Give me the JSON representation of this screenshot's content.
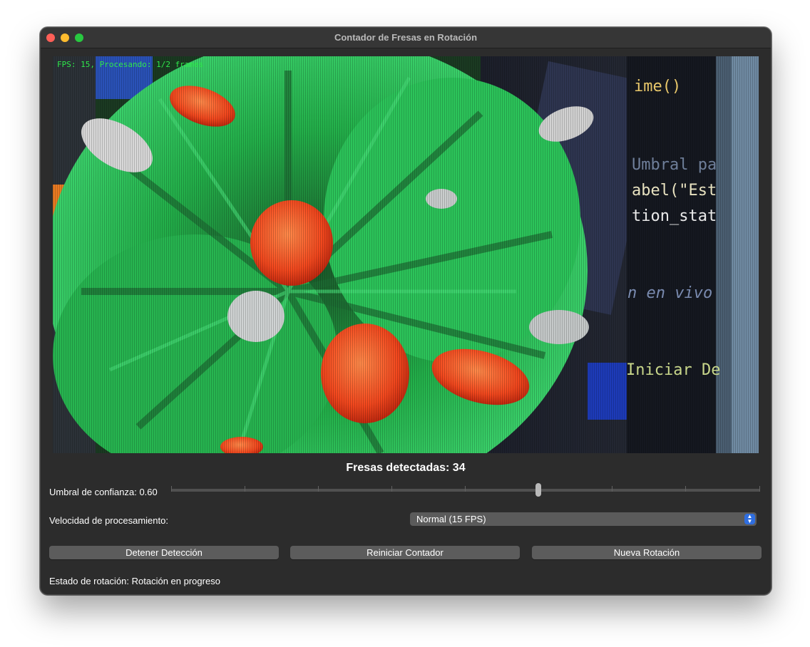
{
  "window": {
    "title": "Contador de Fresas en Rotación"
  },
  "video": {
    "overlay_text": "FPS: 15, Procesando: 1/2 frames",
    "code_lines": [
      "ime()",
      "Umbral pa",
      "abel(\"Est",
      "tion_stat",
      "n en vivo",
      "Iniciar De"
    ]
  },
  "counter": {
    "text": "Fresas detectadas: 34"
  },
  "confidence": {
    "label": "Umbral de confianza: 0.60",
    "value": 0.6
  },
  "speed": {
    "label": "Velocidad de procesamiento:",
    "selected": "Normal (15 FPS)"
  },
  "buttons": {
    "stop": "Detener Detección",
    "reset": "Reiniciar Contador",
    "new_rotation": "Nueva Rotación"
  },
  "status": {
    "text": "Estado de rotación: Rotación en progreso"
  },
  "colors": {
    "accent": "#2f6ee0",
    "overlay_green": "#2ee84a"
  }
}
